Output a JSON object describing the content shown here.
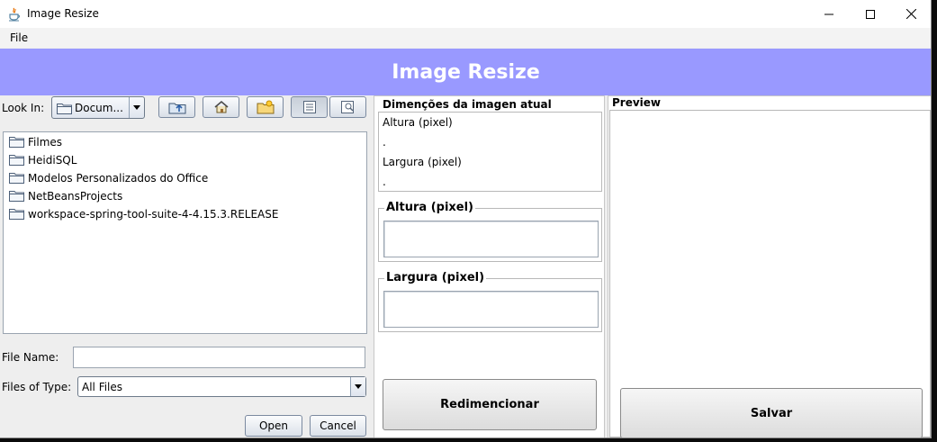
{
  "window": {
    "title": "Image Resize",
    "controls": [
      "minimize-icon",
      "maximize-icon",
      "close-icon"
    ]
  },
  "menu": {
    "file": "File"
  },
  "banner": {
    "title": "Image Resize",
    "color": "#9999ff"
  },
  "chooser": {
    "look_in_label": "Look In:",
    "look_in_value": "Docum...",
    "toolbar_icons": [
      "up-folder-icon",
      "home-icon",
      "new-folder-icon",
      "list-view-icon",
      "details-view-icon"
    ],
    "files": [
      "Filmes",
      "HeidiSQL",
      "Modelos Personalizados do Office",
      "NetBeansProjects",
      "workspace-spring-tool-suite-4-4.15.3.RELEASE"
    ],
    "file_name_label": "File Name:",
    "file_name_value": "",
    "files_of_type_label": "Files of Type:",
    "files_of_type_value": "All Files",
    "open_button": "Open",
    "cancel_button": "Cancel"
  },
  "dimensions": {
    "title": "Dimenções da imagen atual",
    "altura_label": "Altura (pixel)",
    "altura_value": ".",
    "largura_label": "Largura (pixel)",
    "largura_value": "."
  },
  "inputs": {
    "altura_legend": "Altura (pixel)",
    "altura_value": "",
    "largura_legend": "Largura (pixel)",
    "largura_value": ""
  },
  "actions": {
    "resize_button": "Redimencionar",
    "save_button": "Salvar"
  },
  "preview": {
    "title": "Preview"
  }
}
